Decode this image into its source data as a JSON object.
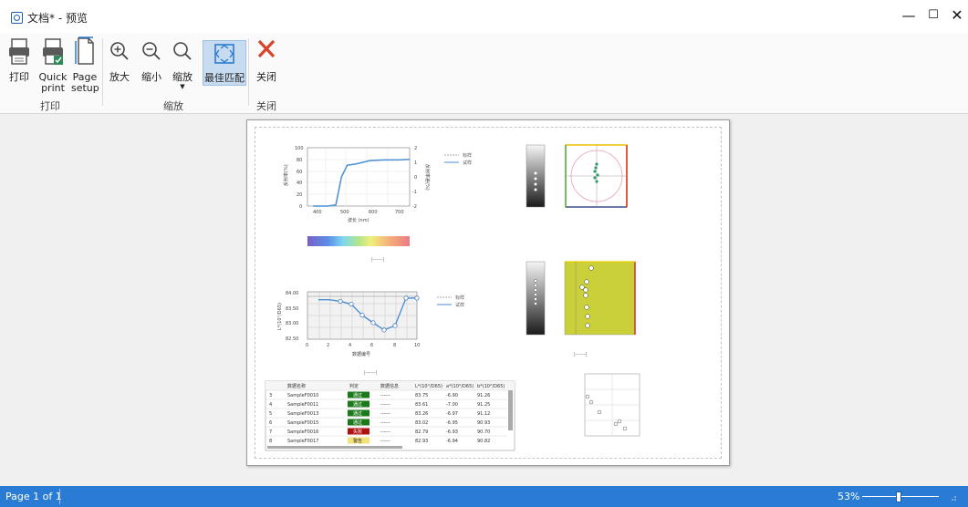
{
  "window": {
    "title": "文档* - 预览"
  },
  "ribbon": {
    "print_label": "打印",
    "quick_print_label_1": "Quick",
    "quick_print_label_2": "print",
    "page_setup_label_1": "Page",
    "page_setup_label_2": "setup",
    "print_group_label": "打印",
    "zoom_in_label": "放大",
    "zoom_out_label": "缩小",
    "zoom_label": "缩放",
    "best_fit_label": "最佳匹配",
    "zoom_group_label": "缩放",
    "close_label": "关闭",
    "close_group_label": "关闭"
  },
  "report": {
    "spectrum_legend": [
      "标样",
      "试样"
    ],
    "spectrum_xlabel": "波长 (nm)",
    "spectrum_ylabel_left": "反射率(%)",
    "spectrum_ylabel_right": "反射率差(%)",
    "spectrum_yticks_left": [
      "100",
      "80",
      "60",
      "40",
      "20",
      "0"
    ],
    "spectrum_yticks_right": [
      "2",
      "1",
      "0",
      "-1",
      "-2"
    ],
    "spectrum_xticks": [
      "400",
      "500",
      "600",
      "700"
    ],
    "trend_legend": [
      "标样",
      "试样"
    ],
    "trend_xlabel": "数据编号",
    "trend_ylabel": "L*(10°/D65)",
    "trend_yticks": [
      "84.00",
      "83.50",
      "83.00",
      "82.50"
    ],
    "trend_xticks": [
      "0",
      "2",
      "4",
      "6",
      "8",
      "10"
    ],
    "table_headers": [
      "",
      "数据名称",
      "判定",
      "数据信息",
      "L*(10°/D65)",
      "a*(10°/D65)",
      "b*(10°/D65)"
    ],
    "table_rows": [
      {
        "no": "3",
        "name": "SampleF0010",
        "status": "通过",
        "info": "------",
        "L": "83.75",
        "a": "-6.90",
        "b": "91.26",
        "color": "#1a7a1a",
        "text": "#ffffff"
      },
      {
        "no": "4",
        "name": "SampleF0011",
        "status": "通过",
        "info": "------",
        "L": "83.61",
        "a": "-7.00",
        "b": "91.25",
        "color": "#1a7a1a",
        "text": "#ffffff"
      },
      {
        "no": "5",
        "name": "SampleF0013",
        "status": "通过",
        "info": "------",
        "L": "83.26",
        "a": "-6.97",
        "b": "91.12",
        "color": "#1a7a1a",
        "text": "#ffffff"
      },
      {
        "no": "6",
        "name": "SampleF0015",
        "status": "通过",
        "info": "------",
        "L": "83.02",
        "a": "-6.95",
        "b": "90.93",
        "color": "#1a7a1a",
        "text": "#ffffff"
      },
      {
        "no": "7",
        "name": "SampleF0016",
        "status": "失败",
        "info": "------",
        "L": "82.79",
        "a": "-6.93",
        "b": "90.70",
        "color": "#b01010",
        "text": "#ffffff"
      },
      {
        "no": "8",
        "name": "SampleF0017",
        "status": "警告",
        "info": "------",
        "L": "82.93",
        "a": "-6.94",
        "b": "90.82",
        "color": "#f2e27a",
        "text": "#333333"
      }
    ]
  },
  "chart_data": [
    {
      "type": "line",
      "x": [
        400,
        450,
        480,
        500,
        520,
        550,
        600,
        650,
        700,
        740
      ],
      "series": [
        {
          "name": "标样",
          "values": [
            0,
            0,
            2,
            50,
            70,
            72,
            78,
            79,
            79,
            80
          ]
        }
      ],
      "xlabel": "波长 (nm)",
      "ylabel": "反射率(%)",
      "ylim": [
        0,
        100
      ]
    },
    {
      "type": "line",
      "x": [
        1,
        2,
        3,
        4,
        5,
        6,
        7,
        8,
        9,
        10
      ],
      "series": [
        {
          "name": "试样",
          "values": [
            83.75,
            83.75,
            83.7,
            83.61,
            83.26,
            83.02,
            82.79,
            82.93,
            83.8,
            83.8
          ]
        }
      ],
      "xlabel": "数据编号",
      "ylabel": "L*(10°/D65)",
      "ylim": [
        82.5,
        84.0
      ]
    }
  ],
  "status": {
    "page": "Page 1 of 1",
    "zoom": "53%"
  }
}
